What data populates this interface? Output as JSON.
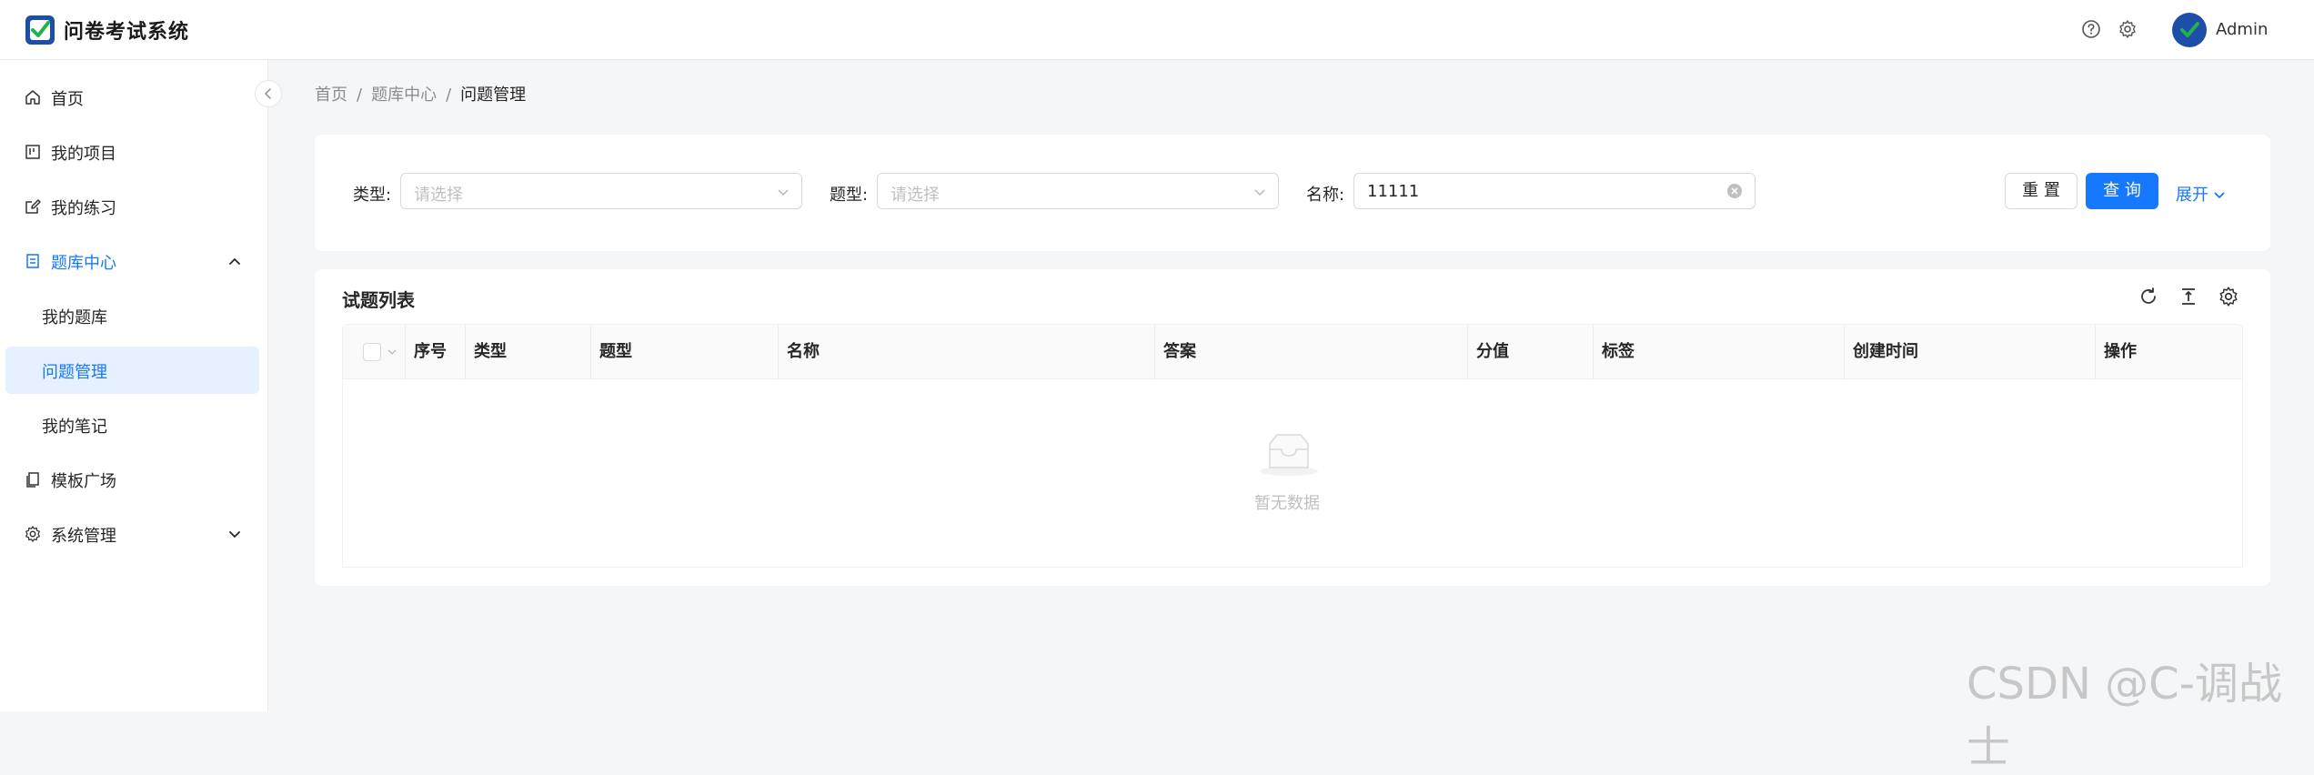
{
  "header": {
    "app_title": "问卷考试系统",
    "user_name": "Admin"
  },
  "sidebar": {
    "items": [
      {
        "label": "首页"
      },
      {
        "label": "我的项目"
      },
      {
        "label": "我的练习"
      },
      {
        "label": "题库中心",
        "children": [
          {
            "label": "我的题库"
          },
          {
            "label": "问题管理"
          },
          {
            "label": "我的笔记"
          }
        ]
      },
      {
        "label": "模板广场"
      },
      {
        "label": "系统管理"
      }
    ]
  },
  "breadcrumb": {
    "items": [
      "首页",
      "题库中心",
      "问题管理"
    ],
    "separator": "/"
  },
  "filters": {
    "type_label": "类型:",
    "type_placeholder": "请选择",
    "qtype_label": "题型:",
    "qtype_placeholder": "请选择",
    "name_label": "名称:",
    "name_value": "11111",
    "reset_label": "重 置",
    "query_label": "查 询",
    "expand_label": "展开"
  },
  "table": {
    "title": "试题列表",
    "columns": [
      "序号",
      "类型",
      "题型",
      "名称",
      "答案",
      "分值",
      "标签",
      "创建时间",
      "操作"
    ],
    "empty_text": "暂无数据"
  },
  "watermark": "CSDN @C-调战士",
  "colors": {
    "accent": "#1677ff",
    "selected_bg": "#e6f0ff",
    "page_bg": "#f5f6f8"
  }
}
